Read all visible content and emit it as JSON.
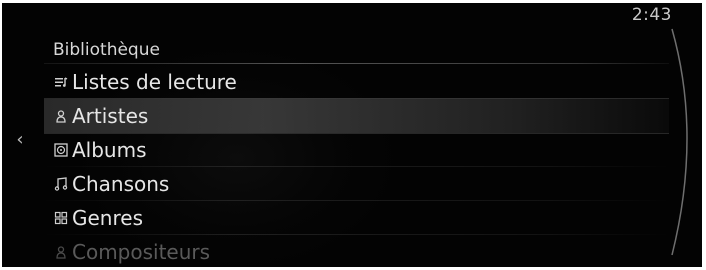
{
  "status": {
    "time": "2:43"
  },
  "navigation": {
    "back_icon": "chevron-left-icon"
  },
  "header": {
    "title": "Bibliothèque"
  },
  "menu": {
    "items": [
      {
        "label": "Listes de lecture",
        "icon": "playlist-icon",
        "selected": false
      },
      {
        "label": "Artistes",
        "icon": "person-icon",
        "selected": true
      },
      {
        "label": "Albums",
        "icon": "album-icon",
        "selected": false
      },
      {
        "label": "Chansons",
        "icon": "music-note-icon",
        "selected": false
      },
      {
        "label": "Genres",
        "icon": "genres-grid-icon",
        "selected": false
      },
      {
        "label": "Compositeurs",
        "icon": "person-icon",
        "selected": false
      }
    ]
  },
  "colors": {
    "background": "#030303",
    "text": "#e6e6e6",
    "selected_highlight": "#3a3a3a"
  }
}
